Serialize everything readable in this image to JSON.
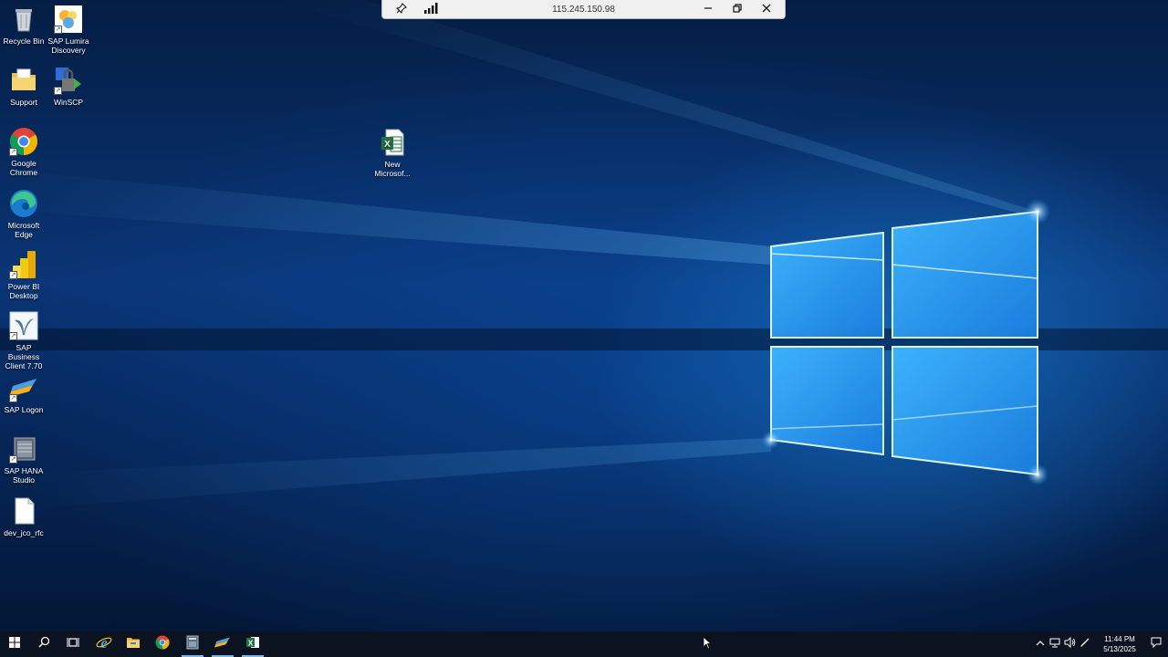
{
  "rdp_bar": {
    "host": "115.245.150.98"
  },
  "desktop_icons": [
    {
      "id": "recycle-bin",
      "label": "Recycle Bin"
    },
    {
      "id": "sap-lumira",
      "label": "SAP Lumira Discovery"
    },
    {
      "id": "support",
      "label": "Support"
    },
    {
      "id": "winscp",
      "label": "WinSCP"
    },
    {
      "id": "chrome",
      "label": "Google Chrome"
    },
    {
      "id": "edge",
      "label": "Microsoft Edge"
    },
    {
      "id": "powerbi",
      "label": "Power BI Desktop"
    },
    {
      "id": "sap-business-client",
      "label": "SAP Business Client 7.70"
    },
    {
      "id": "sap-logon",
      "label": "SAP Logon"
    },
    {
      "id": "sap-hana-studio",
      "label": "SAP HANA Studio"
    },
    {
      "id": "dev-jco-rfc",
      "label": "dev_jco_rfc"
    },
    {
      "id": "new-excel",
      "label": "New Microsof..."
    }
  ],
  "taskbar": {
    "pinned": [
      "start",
      "search",
      "task-view",
      "internet-explorer",
      "file-explorer",
      "chrome",
      "app-window",
      "sap-logon",
      "excel"
    ]
  },
  "clock": {
    "time": "11:44 PM",
    "date": "5/13/2025"
  },
  "colors": {
    "taskbar_bg": "#0b1220",
    "accent": "#76b9ed",
    "excel_green": "#1f7244"
  }
}
